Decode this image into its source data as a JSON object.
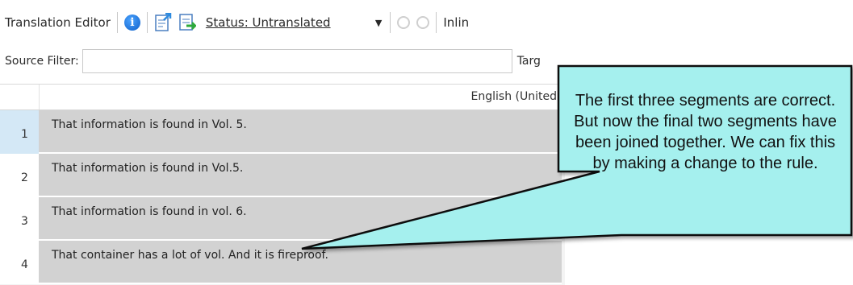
{
  "toolbar": {
    "title": "Translation Editor",
    "status_label": "Status: Untranslated",
    "inline_label": "Inlin"
  },
  "filter": {
    "source_label": "Source Filter:",
    "source_value": "",
    "target_label": "Targ"
  },
  "grid": {
    "column_header": "English (United",
    "rows": [
      {
        "num": "1",
        "text": "That information is found in Vol. 5."
      },
      {
        "num": "2",
        "text": "That information is found in Vol.5."
      },
      {
        "num": "3",
        "text": "That information is found in vol. 6."
      },
      {
        "num": "4",
        "text": "That container has a lot of vol. And it is fireproof."
      }
    ]
  },
  "callout": {
    "text": "The first three segments are correct. But now the final two segments have been joined together. We can fix this by making a change to the rule.",
    "fill_color": "#a5f0ee",
    "border_color": "#111111"
  }
}
